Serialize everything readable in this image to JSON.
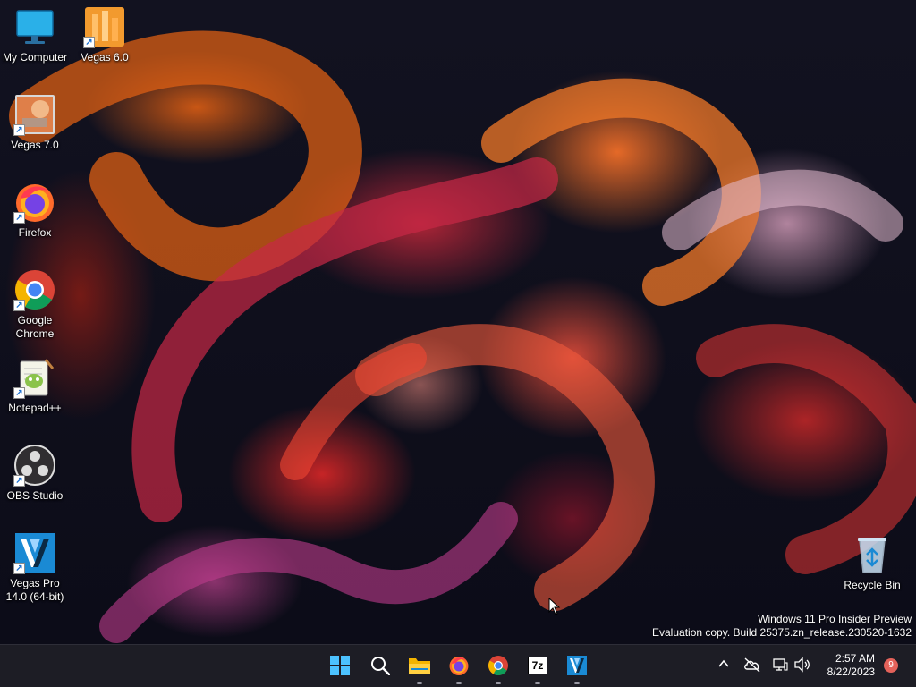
{
  "desktop_icons": [
    {
      "name": "my-computer",
      "label": "My Computer",
      "icon": "monitor-icon",
      "shortcut": false
    },
    {
      "name": "vegas-6",
      "label": "Vegas 6.0",
      "icon": "vegas-6-icon",
      "shortcut": true
    },
    {
      "name": "vegas-7",
      "label": "Vegas 7.0",
      "icon": "vegas-7-icon",
      "shortcut": true
    },
    {
      "name": "firefox",
      "label": "Firefox",
      "icon": "firefox-icon",
      "shortcut": true
    },
    {
      "name": "google-chrome",
      "label": "Google Chrome",
      "icon": "chrome-icon",
      "shortcut": true
    },
    {
      "name": "notepad-plus-plus",
      "label": "Notepad++",
      "icon": "notepad-plus-plus-icon",
      "shortcut": true
    },
    {
      "name": "obs-studio",
      "label": "OBS Studio",
      "icon": "obs-icon",
      "shortcut": true
    },
    {
      "name": "vegas-pro-14",
      "label": "Vegas Pro 14.0 (64-bit)",
      "icon": "vegas-pro-icon",
      "shortcut": true
    },
    {
      "name": "recycle-bin",
      "label": "Recycle Bin",
      "icon": "recycle-bin-icon",
      "shortcut": false
    }
  ],
  "watermark": {
    "line1": "Windows 11 Pro Insider Preview",
    "line2": "Evaluation copy. Build 25375.zn_release.230520-1632"
  },
  "taskbar": {
    "apps": [
      {
        "name": "start",
        "icon": "windows-logo-icon",
        "running": false
      },
      {
        "name": "search",
        "icon": "search-icon",
        "running": false
      },
      {
        "name": "file-explorer",
        "icon": "folder-icon",
        "running": true
      },
      {
        "name": "firefox",
        "icon": "firefox-icon",
        "running": true
      },
      {
        "name": "chrome",
        "icon": "chrome-icon",
        "running": true
      },
      {
        "name": "7zip",
        "icon": "7zip-icon",
        "running": true,
        "text": "7z"
      },
      {
        "name": "vegas-pro",
        "icon": "vegas-pro-icon",
        "running": true
      }
    ],
    "tray": {
      "chevron": "^",
      "time": "2:57 AM",
      "date": "8/22/2023",
      "notification_count": "9"
    }
  },
  "colors": {
    "taskbar_bg": "#1d1d25",
    "accent_blue": "#1a8ad4",
    "badge": "#e4625a"
  }
}
